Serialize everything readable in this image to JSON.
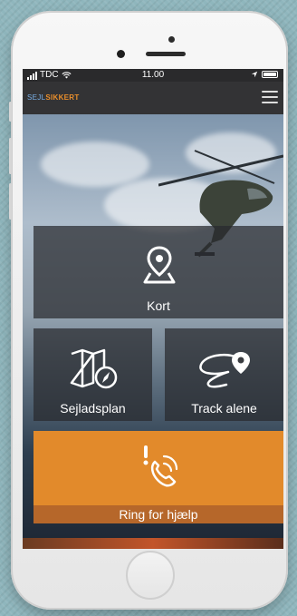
{
  "status": {
    "carrier": "TDC",
    "time": "11.00"
  },
  "header": {
    "logo_part1": "SEJL",
    "logo_part2": "SIKKERT",
    "menu_icon": "hamburger-icon"
  },
  "tiles": {
    "kort": {
      "label": "Kort",
      "icon": "location-pin-icon"
    },
    "sejladsplan": {
      "label": "Sejladsplan",
      "icon": "map-compass-icon"
    },
    "track": {
      "label": "Track alene",
      "icon": "track-route-icon"
    },
    "ring": {
      "label": "Ring for hjælp",
      "icon": "phone-alert-icon"
    }
  },
  "colors": {
    "accent_orange": "#e28a2b",
    "ring_bar": "#b6672a",
    "logo_blue": "#7ab0e8",
    "logo_orange": "#e98e2b"
  }
}
